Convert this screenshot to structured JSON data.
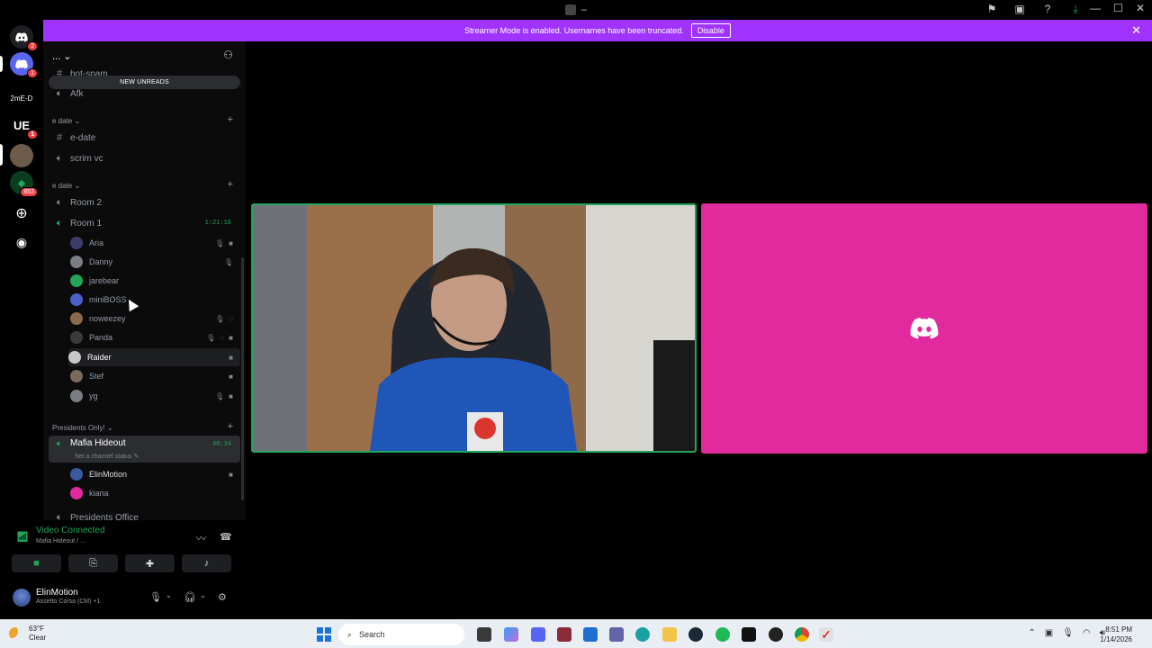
{
  "window": {
    "title": "–"
  },
  "title_icons": [
    "flag-icon",
    "inbox-icon",
    "help-icon",
    "download-icon"
  ],
  "window_controls": [
    "minimize",
    "maximize",
    "close"
  ],
  "server_rail": [
    {
      "label": "",
      "badge": "2",
      "icon": "discord-home-icon",
      "color": "#5865f2"
    },
    {
      "label": "",
      "badge": "1",
      "icon": "discord-server-icon",
      "color": "#5865f2"
    },
    {
      "label": "2mE-D",
      "badge": "",
      "icon": "",
      "color": "#000000"
    },
    {
      "label": "UE",
      "badge": "1",
      "icon": "",
      "color": "#000000"
    },
    {
      "label": "",
      "badge": "",
      "icon": "photo-server-icon",
      "color": "#6d5a4a"
    },
    {
      "label": "",
      "badge": "853",
      "icon": "green-server-icon",
      "color": "#23a55a"
    }
  ],
  "banner": {
    "text": "Streamer Mode is enabled. Usernames have been truncated.",
    "button": "Disable"
  },
  "server": {
    "name": "..."
  },
  "new_unreads": "NEW UNREADS",
  "channels_top": [
    {
      "name": "bot-spam",
      "type": "text"
    },
    {
      "name": "Afk",
      "type": "voice"
    }
  ],
  "cat1": {
    "name": "e date"
  },
  "cat1_channels": [
    {
      "name": "e-date",
      "type": "text"
    },
    {
      "name": "scrim vc",
      "type": "voice"
    }
  ],
  "cat2": {
    "name": "e date"
  },
  "room2": {
    "name": "Room 2"
  },
  "room1": {
    "name": "Room 1",
    "timer": "1:21:16"
  },
  "room1_users": [
    {
      "name": "Aria",
      "color": "#3b3d6b"
    },
    {
      "name": "Danny",
      "color": "#7a7d84"
    },
    {
      "name": "jarebear",
      "color": "#23a55a"
    },
    {
      "name": "miniBOSS",
      "color": "#4a5fc9"
    },
    {
      "name": "noweezey",
      "color": "#8a6a4a"
    },
    {
      "name": "Panda",
      "color": "#3a3a3a"
    },
    {
      "name": "Raider",
      "color": "#c8c8c8"
    },
    {
      "name": "Stef",
      "color": "#7a6a5a"
    },
    {
      "name": "yg",
      "color": "#7a7d84"
    }
  ],
  "cat3": {
    "name": "Presidents Only!"
  },
  "mafia": {
    "name": "Mafia Hideout",
    "timer": "48:34",
    "status": "Set a channel status"
  },
  "mafia_users": [
    {
      "name": "ElinMotion",
      "color": "#3a5aa0"
    },
    {
      "name": "kiana",
      "color": "#e22a9f"
    }
  ],
  "presidents_office": {
    "name": "Presidents Office"
  },
  "voice": {
    "status": "Video Connected",
    "channel": "Mafia Hideout / ..."
  },
  "user": {
    "name": "ElinMotion",
    "activity": "Assetto Corsa (CM) +1"
  },
  "taskbar": {
    "weather_temp": "63°F",
    "weather_desc": "Clear",
    "search": "Search",
    "time": "8:51 PM",
    "date": "1/14/2026"
  }
}
